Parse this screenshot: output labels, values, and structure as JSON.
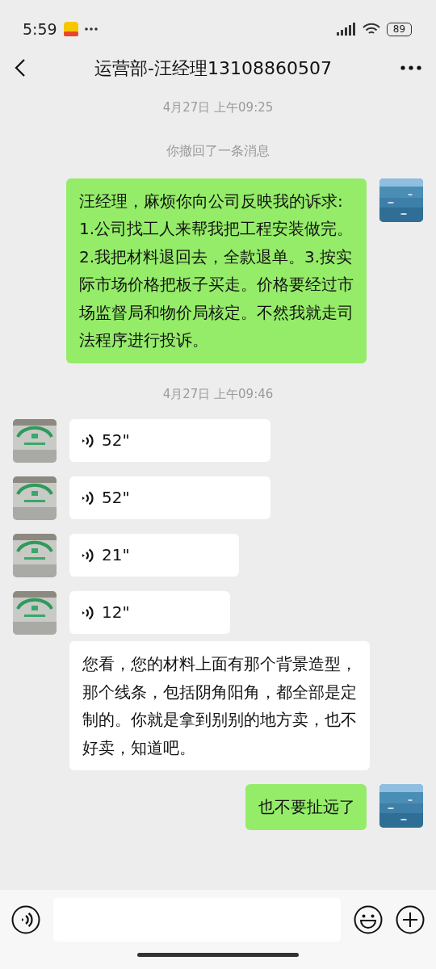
{
  "status_bar": {
    "time": "5:59",
    "battery": "89"
  },
  "header": {
    "title": "运营部-汪经理13108860507"
  },
  "messages": [
    {
      "kind": "time",
      "text": "4月27日 上午09:25"
    },
    {
      "kind": "system",
      "text": "你撤回了一条消息"
    },
    {
      "kind": "text",
      "outgoing": true,
      "text": "汪经理，麻烦你向公司反映我的诉求:1.公司找工人来帮我把工程安装做完。2.我把材料退回去，全款退单。3.按实际市场价格把板子买走。价格要经过市场监督局和物价局核定。不然我就走司法程序进行投诉。"
    },
    {
      "kind": "time",
      "text": "4月27日 上午09:46"
    },
    {
      "kind": "voice",
      "outgoing": false,
      "duration": "52\""
    },
    {
      "kind": "voice",
      "outgoing": false,
      "duration": "52\""
    },
    {
      "kind": "voice",
      "outgoing": false,
      "duration": "21\""
    },
    {
      "kind": "voice",
      "outgoing": false,
      "duration": "12\"",
      "transcript": "您看，您的材料上面有那个背景造型，那个线条，包括阴角阳角，都全部是定制的。你就是拿到别别的地方卖，也不好卖，知道吧。"
    },
    {
      "kind": "text",
      "outgoing": true,
      "text": "也不要扯远了"
    }
  ]
}
